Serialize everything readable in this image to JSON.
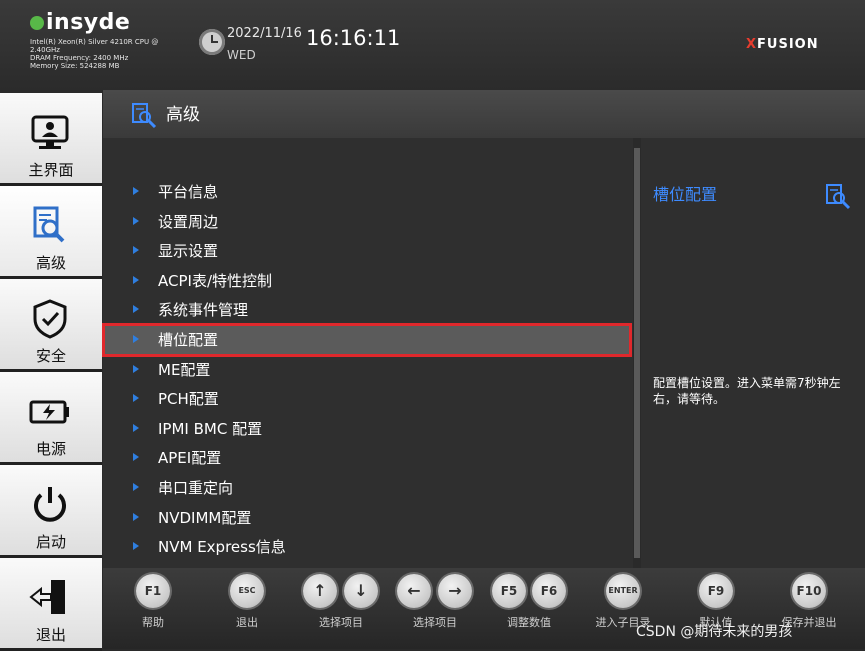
{
  "header": {
    "logo": "insyde",
    "cpu": "Intel(R) Xeon(R) Silver 4210R CPU @ 2.40GHz",
    "dram": "DRAM Frequency: 2400 MHz",
    "memory": "Memory Size: 524288 MB",
    "date": "2022/11/16",
    "weekday": "WED",
    "time": "16:16:11",
    "brand_x": "X",
    "brand": "FUSION"
  },
  "nav": {
    "items": [
      {
        "label": "主界面",
        "icon": "monitor-icon"
      },
      {
        "label": "高级",
        "icon": "advanced-icon"
      },
      {
        "label": "安全",
        "icon": "shield-icon"
      },
      {
        "label": "电源",
        "icon": "battery-icon"
      },
      {
        "label": "启动",
        "icon": "power-icon"
      },
      {
        "label": "退出",
        "icon": "exit-icon"
      }
    ],
    "active": "高级"
  },
  "main": {
    "title": "高级",
    "menu": [
      {
        "label": "平台信息"
      },
      {
        "label": "设置周边"
      },
      {
        "label": "显示设置"
      },
      {
        "label": "ACPI表/特性控制"
      },
      {
        "label": "系统事件管理"
      },
      {
        "label": "槽位配置"
      },
      {
        "label": "ME配置"
      },
      {
        "label": "PCH配置"
      },
      {
        "label": "IPMI BMC  配置"
      },
      {
        "label": "APEI配置"
      },
      {
        "label": "串口重定向"
      },
      {
        "label": "NVDIMM配置"
      },
      {
        "label": "NVM Express信息"
      }
    ],
    "selected": "槽位配置"
  },
  "description": {
    "title": "槽位配置",
    "text": "配置槽位设置。进入菜单需7秒钟左右，请等待。"
  },
  "footer": {
    "keys": [
      {
        "key": "F1",
        "label": "帮助"
      },
      {
        "key": "ESC",
        "label": "退出"
      },
      {
        "key": "↑↓",
        "label": "选择项目"
      },
      {
        "key": "←→",
        "label": "选择项目"
      },
      {
        "key": "F5 F6",
        "label": "调整数值"
      },
      {
        "key": "ENTER",
        "label": "进入子目录"
      },
      {
        "key": "F9",
        "label": "默认值"
      },
      {
        "key": "F10",
        "label": "保存并退出"
      }
    ]
  },
  "watermark": "CSDN @期待未来的男孩",
  "colors": {
    "accent": "#3e8bff",
    "highlight_border": "#e0282c",
    "bullet": "#2f7fe0"
  }
}
